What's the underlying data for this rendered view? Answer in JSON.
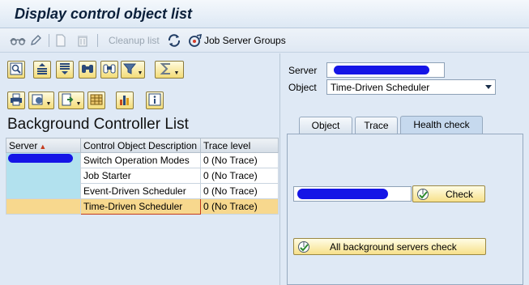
{
  "window": {
    "title": "Display control object list"
  },
  "toolbar": {
    "cleanup_label": "Cleanup list",
    "job_server_groups_label": "Job Server Groups"
  },
  "list": {
    "title": "Background Controller List",
    "columns": [
      "Server",
      "Control Object Description",
      "Trace level"
    ],
    "rows": [
      {
        "description": "Switch Operation Modes",
        "trace": "0 (No Trace)"
      },
      {
        "description": "Job Starter",
        "trace": "0 (No Trace)"
      },
      {
        "description": "Event-Driven Scheduler",
        "trace": "0 (No Trace)"
      },
      {
        "description": "Time-Driven Scheduler",
        "trace": "0 (No Trace)"
      }
    ]
  },
  "details": {
    "server_label": "Server",
    "object_label": "Object",
    "object_value": "Time-Driven Scheduler",
    "tabs": [
      "Object",
      "Trace",
      "Health check"
    ],
    "active_tab": "Health check",
    "check_button": "Check",
    "all_check_button": "All background servers check"
  },
  "icons": [
    "glasses-icon",
    "pencil-icon",
    "new-document-icon",
    "trash-icon",
    "refresh-icon",
    "job-server-groups-icon",
    "details-icon",
    "sort-ascending-icon",
    "sort-descending-icon",
    "find-icon",
    "find-next-icon",
    "filter-icon",
    "sum-icon",
    "print-icon",
    "views-icon",
    "export-icon",
    "layout-icon",
    "graphic-icon",
    "info-icon",
    "check-icon"
  ],
  "colors": {
    "selected_row": "#f7d88e",
    "server_cell": "#b2e1ee",
    "button_fill": "#f3dc78",
    "redaction": "#1515e6"
  }
}
